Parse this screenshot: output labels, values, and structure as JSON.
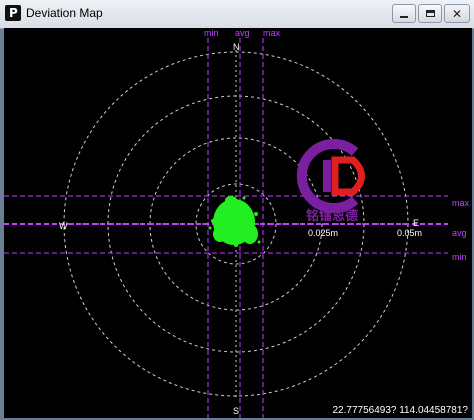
{
  "window": {
    "title": "Deviation Map",
    "app_icon_letter": "P",
    "close_glyph": "✕"
  },
  "map": {
    "north_label": "N",
    "south_label": "S",
    "west_label": "W",
    "east_label": "E",
    "vertical_guides": [
      "min",
      "avg",
      "max"
    ],
    "horizontal_guides": [
      "max",
      "avg",
      "min"
    ],
    "ring_labels": [
      "0.025m",
      "0.05m"
    ],
    "coordinates": "22.77756493? 114.04458781?",
    "watermark_text": "铭镭恩德",
    "colors": {
      "background": "#000000",
      "guide_lines": "#c040ff",
      "grid_rings": "#cfcfcf",
      "points": "#22ee22"
    }
  }
}
